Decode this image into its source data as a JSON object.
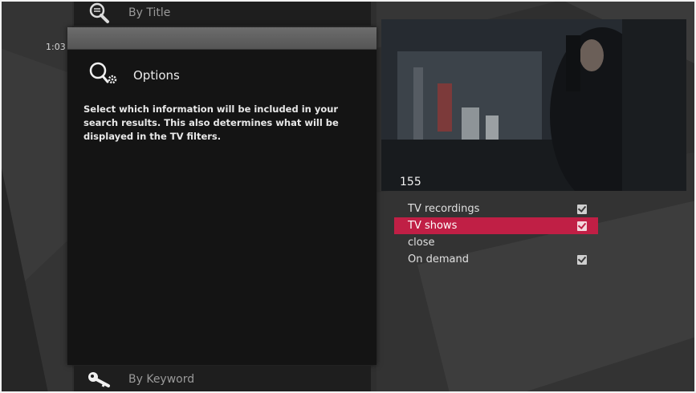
{
  "clock": "1:03",
  "top_menu": {
    "icon": "search-list-icon",
    "label": "By Title"
  },
  "bottom_menu": {
    "icon": "key-icon",
    "label": "By Keyword"
  },
  "options_panel": {
    "icon": "search-gear-icon",
    "title": "Options",
    "description": "Select which information will be included in your search results. This also determines what will be displayed in the TV filters."
  },
  "preview": {
    "channel_number": "155"
  },
  "options": [
    {
      "label": "TV recordings",
      "checked": true,
      "selected": false
    },
    {
      "label": "TV shows",
      "checked": true,
      "selected": true
    },
    {
      "label": "close",
      "checked": false,
      "selected": false
    },
    {
      "label": "On demand",
      "checked": true,
      "selected": false
    }
  ],
  "colors": {
    "highlight": "#c01f45",
    "panel": "#141414",
    "background": "#2f2f2f"
  }
}
